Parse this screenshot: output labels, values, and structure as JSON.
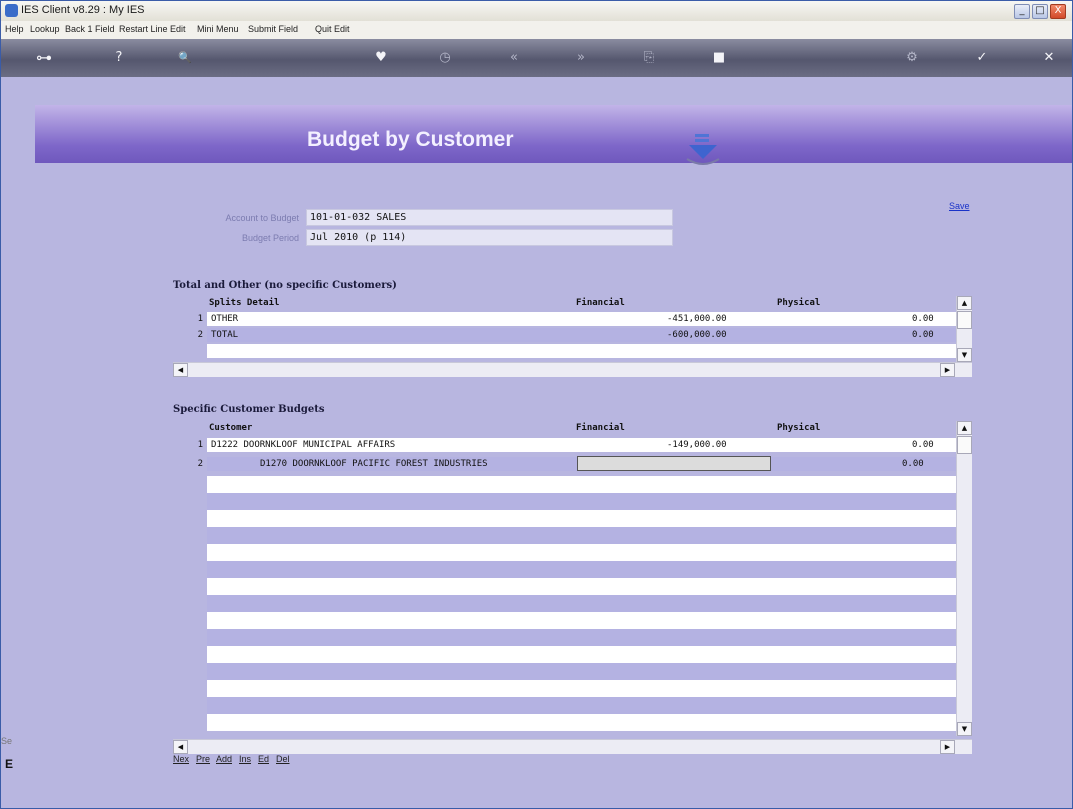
{
  "window": {
    "title": "IES Client v8.29 : My IES",
    "minimize": "_",
    "maximize": "□",
    "close": "X"
  },
  "menu": [
    "Help",
    "Lookup",
    "Back 1 Field",
    "Restart Line Edit",
    "Mini Menu",
    "Submit Field",
    "Quit Edit"
  ],
  "toolbar": {
    "key": "⊶",
    "help": "?",
    "search": "🔍",
    "heart": "♥",
    "clock": "◷",
    "prev": "«",
    "next": "»",
    "copy": "⎘",
    "doc": "■",
    "gear": "⚙",
    "check": "✓",
    "close": "✕"
  },
  "page": {
    "heading": "Budget by Customer",
    "save_label": "Save"
  },
  "fields": {
    "account_label": "Account to Budget",
    "account_value": "101-01-032 SALES",
    "period_label": "Budget Period",
    "period_value": "Jul 2010 (p 114)"
  },
  "totals": {
    "title": "Total and Other (no specific Customers)",
    "columns": [
      "Splits Detail",
      "Financial",
      "Physical"
    ],
    "rows": [
      {
        "num": "1",
        "detail": "OTHER",
        "financial": "-451,000.00",
        "physical": "0.00"
      },
      {
        "num": "2",
        "detail": "TOTAL",
        "financial": "-600,000.00",
        "physical": "0.00"
      }
    ]
  },
  "customers": {
    "title": "Specific Customer Budgets",
    "columns": [
      "Customer",
      "Financial",
      "Physical"
    ],
    "rows": [
      {
        "num": "1",
        "customer": "D1222 DOORNKLOOF MUNICIPAL AFFAIRS",
        "financial": "-149,000.00",
        "physical": "0.00"
      },
      {
        "num": "2",
        "customer": "D1270 DOORNKLOOF PACIFIC FOREST INDUSTRIES",
        "financial": "",
        "physical": "0.00"
      }
    ]
  },
  "nav": [
    "Nex",
    "Pre",
    "Add",
    "Ins",
    "Ed",
    "Del"
  ],
  "stubs": {
    "s1": "Se",
    "s2": "E"
  }
}
